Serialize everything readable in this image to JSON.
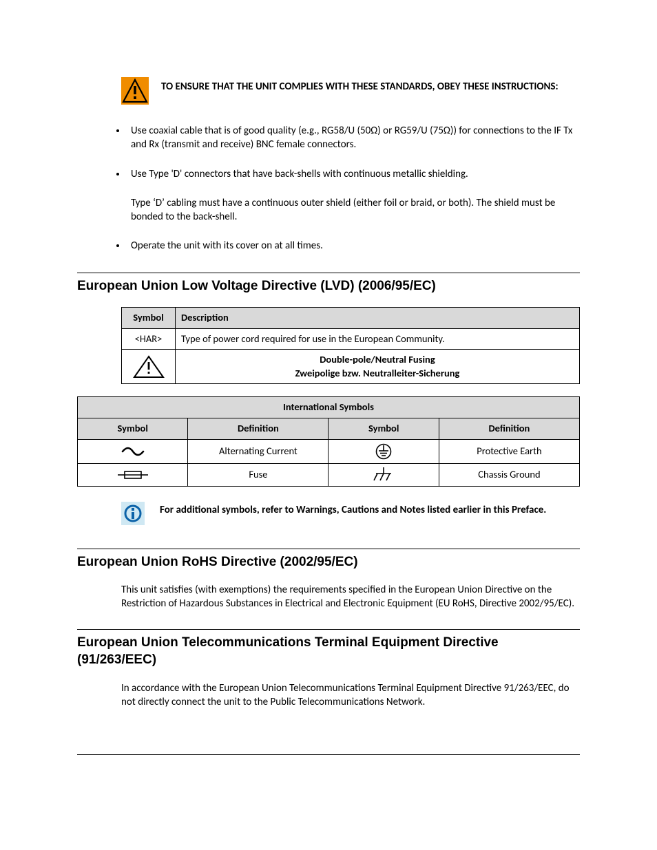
{
  "warning_block": {
    "text": "TO ENSURE THAT THE UNIT COMPLIES WITH THESE STANDARDS, OBEY THESE INSTRUCTIONS:"
  },
  "bullets": {
    "b1": "Use coaxial cable that is of good quality (e.g., RG58/U (50Ω) or RG59/U (75Ω)) for connections to the IF Tx and Rx (transmit and receive) BNC female connectors.",
    "b2": "Use Type 'D' connectors that have back-shells with continuous metallic shielding.",
    "b2_para2": "Type ‘D’ cabling must have a continuous outer shield (either foil or braid, or both). The shield must be bonded to the back-shell.",
    "b3": "Operate the unit with its cover on at all times."
  },
  "section_lvd": {
    "heading": "European Union Low Voltage Directive (LVD) (2006/95/EC)",
    "table1": {
      "h_symbol": "Symbol",
      "h_desc": "Description",
      "r1_sym": "<HAR>",
      "r1_desc": "Type of power cord required for use in the European Community.",
      "r2_line1": "Double-pole/Neutral Fusing",
      "r2_line2": "Zweipolige bzw. Neutralleiter-Sicherung"
    },
    "table2": {
      "title": "International Symbols",
      "h_symbol": "Symbol",
      "h_def": "Definition",
      "d_ac": "Alternating Current",
      "d_pe": "Protective Earth",
      "d_fuse": "Fuse",
      "d_cg": "Chassis Ground"
    },
    "info_text": "For additional symbols, refer to Warnings, Cautions and Notes listed earlier in this Preface."
  },
  "section_rohs": {
    "heading": "European Union RoHS Directive (2002/95/EC)",
    "body": "This unit satisfies (with exemptions) the requirements specified in the European Union Directive on the Restriction of Hazardous Substances in Electrical and Electronic Equipment (EU RoHS, Directive 2002/95/EC)."
  },
  "section_tte": {
    "heading": "European Union Telecommunications Terminal Equipment Directive (91/263/EEC)",
    "body": "In accordance with the European Union Telecommunications Terminal Equipment Directive 91/263/EEC, do not directly connect the unit to the Public Telecommunications Network."
  }
}
